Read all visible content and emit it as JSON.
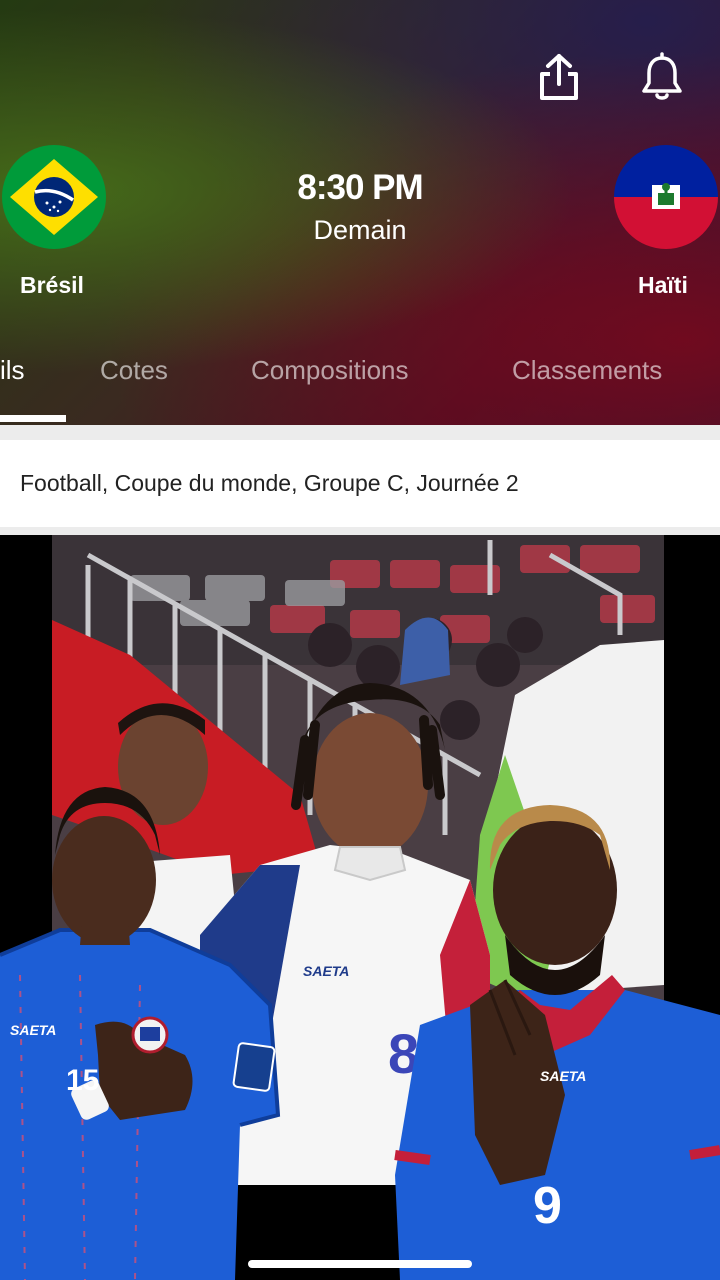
{
  "match": {
    "time": "8:30 PM",
    "day": "Demain",
    "home_team": {
      "name": "Brésil"
    },
    "away_team": {
      "name": "Haïti"
    }
  },
  "tabs": [
    {
      "label": "ils",
      "active": true
    },
    {
      "label": "Cotes",
      "active": false
    },
    {
      "label": "Compositions",
      "active": false
    },
    {
      "label": "Classements",
      "active": false
    }
  ],
  "competition_info": "Football, Coupe du monde, Groupe C, Journée 2",
  "media": {
    "shirt_brand": "SAETA",
    "jersey_number_center": "8",
    "jersey_number_left": "15",
    "jersey_number_right": "9"
  },
  "icons": {
    "share": "share-icon",
    "bell": "bell-icon"
  },
  "colors": {
    "brazil_green": "#009b3a",
    "brazil_yellow": "#fedf00",
    "brazil_blue": "#002776",
    "haiti_blue": "#00209f",
    "haiti_red": "#d21034"
  }
}
